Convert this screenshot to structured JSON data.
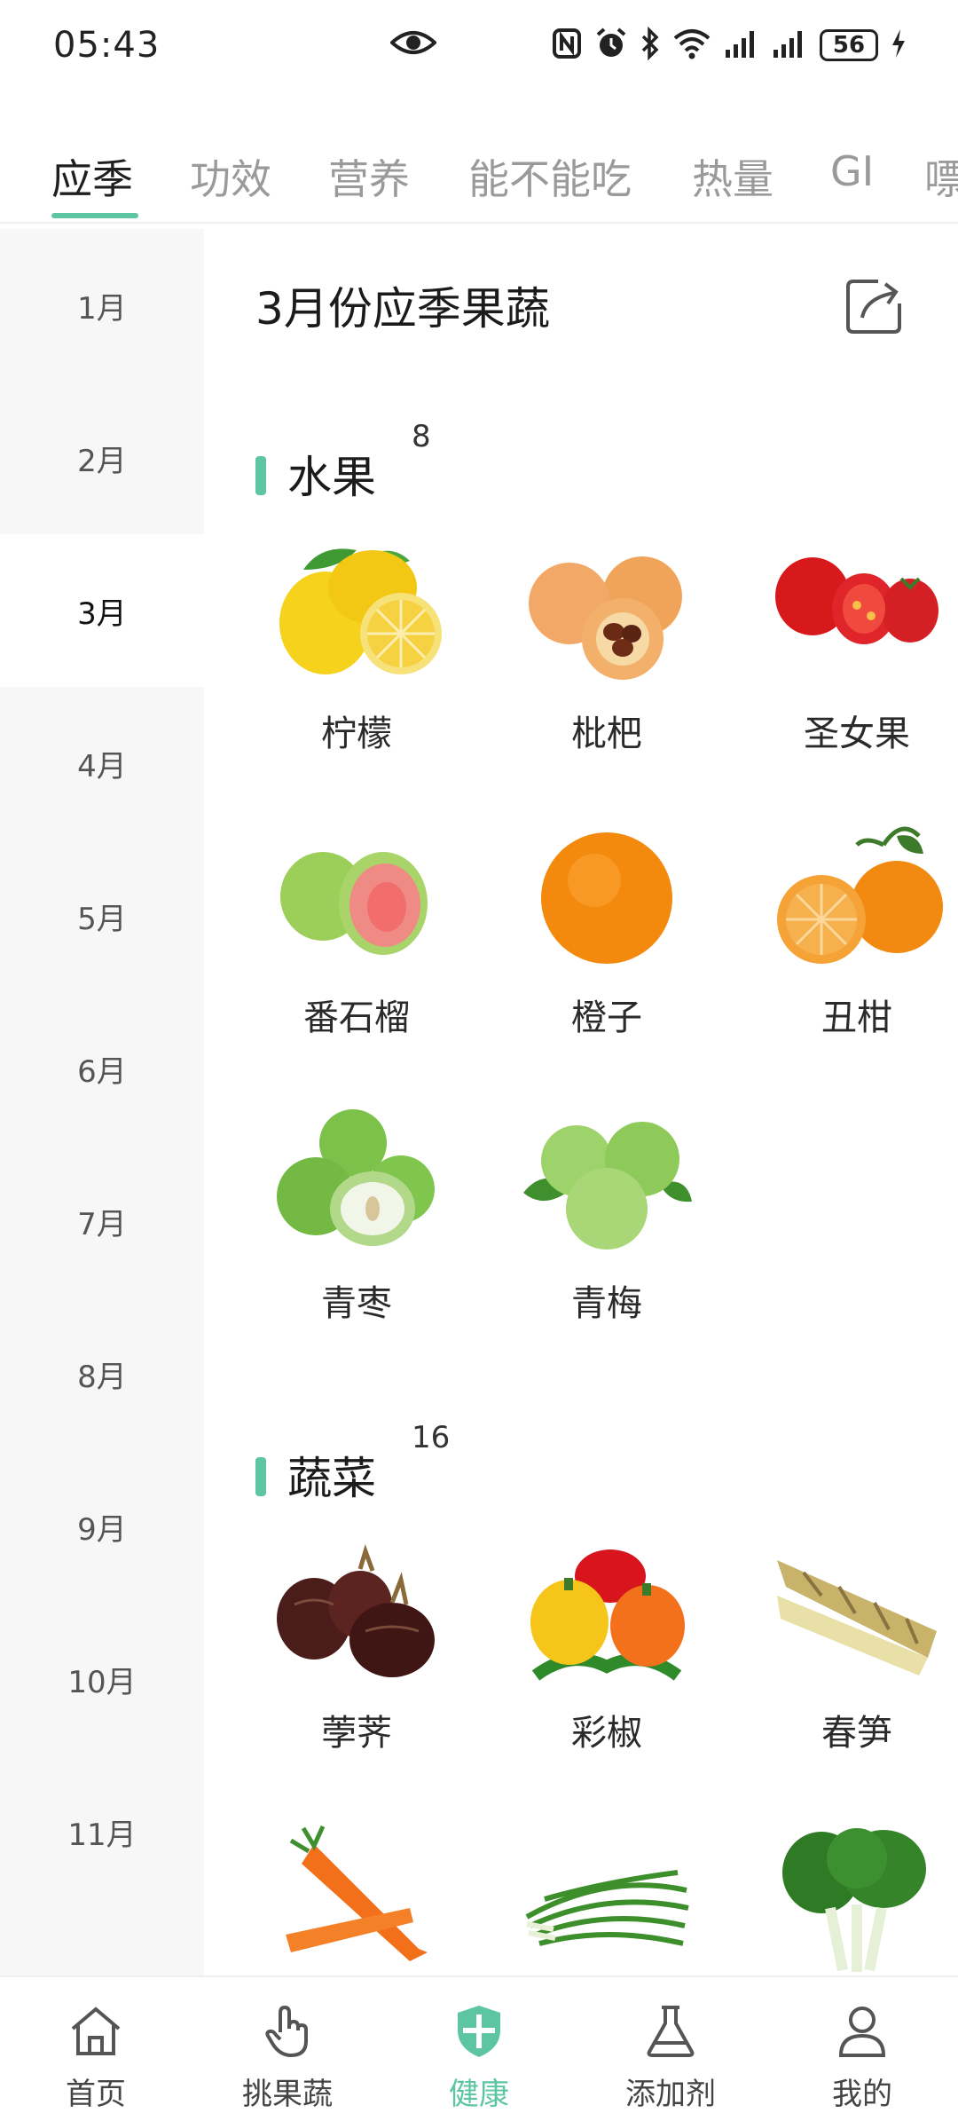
{
  "status_bar": {
    "time": "05:43",
    "battery": "56",
    "icons": [
      "eye-icon",
      "nfc-icon",
      "alarm-icon",
      "bluetooth-icon",
      "wifi-icon",
      "signal-icon",
      "signal-icon",
      "battery-icon",
      "charging-icon"
    ]
  },
  "tabs": [
    {
      "label": "应季",
      "active": true
    },
    {
      "label": "功效"
    },
    {
      "label": "营养"
    },
    {
      "label": "能不能吃"
    },
    {
      "label": "热量"
    },
    {
      "label": "GI"
    },
    {
      "label": "嘌"
    }
  ],
  "months": [
    "1月",
    "2月",
    "3月",
    "4月",
    "5月",
    "6月",
    "7月",
    "8月",
    "9月",
    "10月",
    "11月"
  ],
  "active_month": "3月",
  "main": {
    "title": "3月份应季果蔬",
    "share_icon": "share-icon"
  },
  "sections": [
    {
      "title": "水果",
      "count": "8",
      "items": [
        {
          "name": "柠檬",
          "icon": "lemon"
        },
        {
          "name": "枇杷",
          "icon": "loquat"
        },
        {
          "name": "圣女果",
          "icon": "cherry-tomato"
        },
        {
          "name": "番石榴",
          "icon": "guava"
        },
        {
          "name": "橙子",
          "icon": "orange"
        },
        {
          "name": "丑柑",
          "icon": "ugli-fruit"
        },
        {
          "name": "青枣",
          "icon": "green-jujube"
        },
        {
          "name": "青梅",
          "icon": "green-plum"
        }
      ]
    },
    {
      "title": "蔬菜",
      "count": "16",
      "items": [
        {
          "name": "荸荠",
          "icon": "water-chestnut"
        },
        {
          "name": "彩椒",
          "icon": "bell-pepper"
        },
        {
          "name": "春笋",
          "icon": "bamboo-shoot"
        },
        {
          "name": "",
          "icon": "carrot"
        },
        {
          "name": "",
          "icon": "chives"
        },
        {
          "name": "",
          "icon": "greens"
        }
      ]
    }
  ],
  "bottom_nav": [
    {
      "label": "首页",
      "icon": "home-icon"
    },
    {
      "label": "挑果蔬",
      "icon": "hand-icon"
    },
    {
      "label": "健康",
      "icon": "health-shield-icon",
      "active": true
    },
    {
      "label": "添加剂",
      "icon": "flask-icon"
    },
    {
      "label": "我的",
      "icon": "user-icon"
    }
  ],
  "colors": {
    "accent": "#5ec5a2",
    "month_bg": "#f7f7f7",
    "tab_inactive": "#9a9a9a"
  }
}
